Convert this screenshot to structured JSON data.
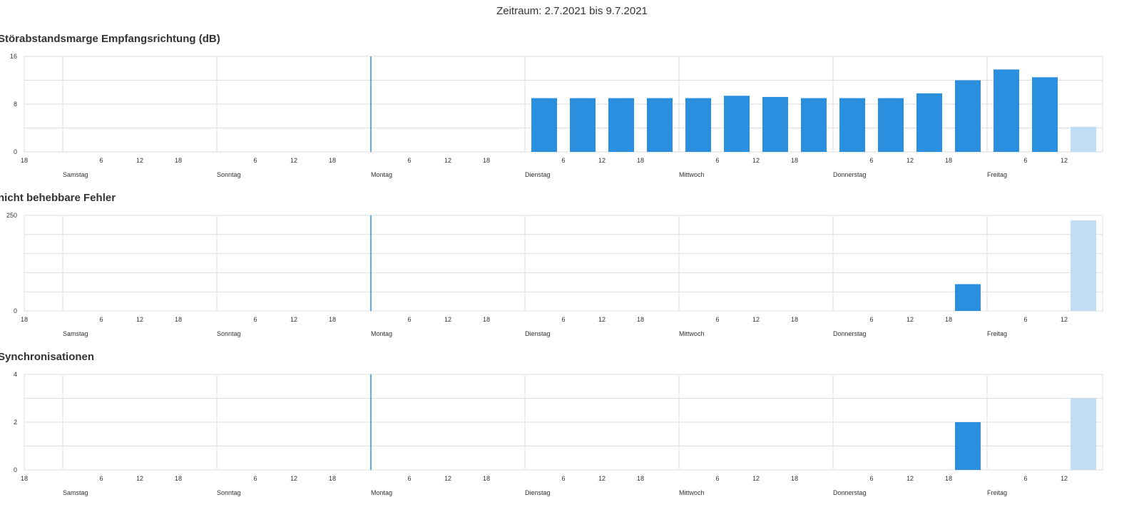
{
  "header": {
    "period": "Zeitraum: 2.7.2021 bis 9.7.2021"
  },
  "colors": {
    "bar": "#2b8fe0",
    "bar_current": "#c0ddf3",
    "marker": "#2b8fe0",
    "grid": "#dddddd"
  },
  "time_axis": {
    "hour_ticks": [
      {
        "hour": 18,
        "label": "18"
      },
      {
        "hour": 30,
        "label": "6"
      },
      {
        "hour": 36,
        "label": "12"
      },
      {
        "hour": 42,
        "label": "18"
      },
      {
        "hour": 54,
        "label": "6"
      },
      {
        "hour": 60,
        "label": "12"
      },
      {
        "hour": 66,
        "label": "18"
      },
      {
        "hour": 78,
        "label": "6"
      },
      {
        "hour": 84,
        "label": "12"
      },
      {
        "hour": 90,
        "label": "18"
      },
      {
        "hour": 102,
        "label": "6"
      },
      {
        "hour": 108,
        "label": "12"
      },
      {
        "hour": 114,
        "label": "18"
      },
      {
        "hour": 126,
        "label": "6"
      },
      {
        "hour": 132,
        "label": "12"
      },
      {
        "hour": 138,
        "label": "18"
      },
      {
        "hour": 150,
        "label": "6"
      },
      {
        "hour": 156,
        "label": "12"
      },
      {
        "hour": 162,
        "label": "18"
      },
      {
        "hour": 174,
        "label": "6"
      },
      {
        "hour": 180,
        "label": "12"
      }
    ],
    "days": [
      {
        "hour": 24,
        "label": "Samstag"
      },
      {
        "hour": 48,
        "label": "Sonntag"
      },
      {
        "hour": 72,
        "label": "Montag"
      },
      {
        "hour": 96,
        "label": "Dienstag"
      },
      {
        "hour": 120,
        "label": "Mittwoch"
      },
      {
        "hour": 144,
        "label": "Donnerstag"
      },
      {
        "hour": 168,
        "label": "Freitag"
      }
    ],
    "marker_hour": 72
  },
  "chart_data": [
    {
      "type": "bar",
      "title": "Störabstandsmarge Empfangsrichtung (dB)",
      "ylim": [
        0,
        16
      ],
      "y_ticks": [
        0,
        8,
        16
      ],
      "y_gridlines": [
        4,
        8,
        12
      ],
      "grid": true,
      "bars": [
        {
          "start": 97,
          "value": 9
        },
        {
          "start": 103,
          "value": 9
        },
        {
          "start": 109,
          "value": 9
        },
        {
          "start": 115,
          "value": 9
        },
        {
          "start": 121,
          "value": 9
        },
        {
          "start": 127,
          "value": 9.4
        },
        {
          "start": 133,
          "value": 9.2
        },
        {
          "start": 139,
          "value": 9
        },
        {
          "start": 145,
          "value": 9
        },
        {
          "start": 151,
          "value": 9
        },
        {
          "start": 157,
          "value": 9.8
        },
        {
          "start": 163,
          "value": 12
        },
        {
          "start": 169,
          "value": 13.8
        },
        {
          "start": 175,
          "value": 12.5
        },
        {
          "start": 181,
          "value": 4.2,
          "current": true
        }
      ]
    },
    {
      "type": "bar",
      "title": "nicht behebbare Fehler",
      "ylim": [
        0,
        250
      ],
      "y_ticks": [
        0,
        250
      ],
      "y_gridlines": [
        50,
        100,
        150,
        200
      ],
      "grid": true,
      "bars": [
        {
          "start": 163,
          "value": 70
        },
        {
          "start": 181,
          "value": 237,
          "current": true
        }
      ]
    },
    {
      "type": "bar",
      "title": "Synchronisationen",
      "ylim": [
        0,
        4
      ],
      "y_ticks": [
        0,
        2,
        4
      ],
      "y_gridlines": [
        1,
        2,
        3
      ],
      "grid": true,
      "bars": [
        {
          "start": 163,
          "value": 2
        },
        {
          "start": 181,
          "value": 3,
          "current": true
        }
      ]
    }
  ]
}
